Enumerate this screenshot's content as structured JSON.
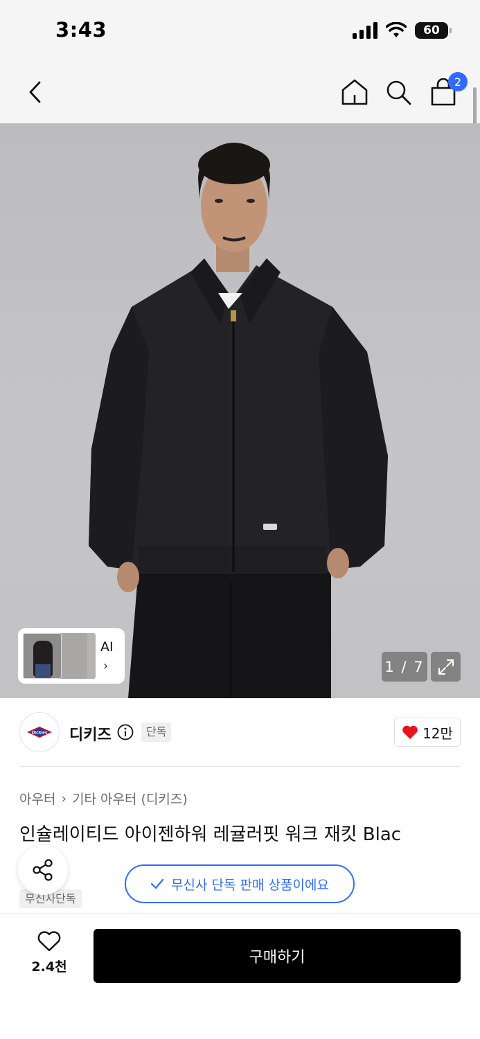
{
  "status_bar": {
    "time": "3:43",
    "battery": "60"
  },
  "nav": {
    "cart_count": "2"
  },
  "gallery": {
    "ai_label": "AI",
    "page_counter": "1 / 7"
  },
  "brand": {
    "name": "디키즈",
    "exclusive_tag": "단독",
    "likes": "12만",
    "logo_text": "Dickies"
  },
  "breadcrumb": {
    "category": "아우터",
    "subcategory": "기타 아우터 (디키즈)"
  },
  "product": {
    "title": "인슐레이티드 아이젠하워 레귤러핏 워크 재킷 Blac",
    "musinsa_tag": "무신사단독",
    "exclusive_banner": "무신사 단독 판매 상품이에요"
  },
  "bottom_bar": {
    "wish_count": "2.4천",
    "buy_label": "구매하기"
  },
  "colors": {
    "accent": "#2f6bff",
    "heart": "#e8141b",
    "buy_button": "#000000"
  }
}
